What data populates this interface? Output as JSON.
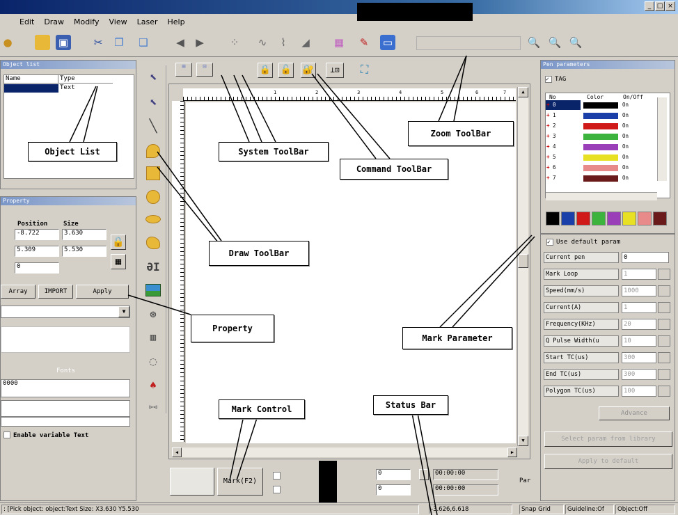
{
  "window": {
    "controls": [
      "_",
      "□",
      "×"
    ]
  },
  "menu": [
    "Edit",
    "Draw",
    "Modify",
    "View",
    "Laser",
    "Help"
  ],
  "object_list": {
    "title": "Object list",
    "columns": [
      "Name",
      "Type"
    ],
    "rows": [
      {
        "name": "",
        "type": "Text"
      }
    ]
  },
  "property": {
    "title": "Property",
    "headers": {
      "position": "Position",
      "size": "Size"
    },
    "x_pos": "-8.722",
    "x_size": "3.630",
    "y_pos": "5.309",
    "y_size": "5.530",
    "z": "0",
    "tabs": [
      "Array",
      "IMPORT",
      "Apply"
    ],
    "fonts_label": "Fonts",
    "text_value": "0000",
    "enable_variable_text": "Enable variable Text"
  },
  "canvas": {
    "ruler_numbers": [
      "1",
      "2",
      "3",
      "4",
      "5",
      "6",
      "7"
    ]
  },
  "mark_control": {
    "mark_button": "Mark(F2)",
    "field1": "0",
    "field2": "0",
    "time1": "00:00:00",
    "time2": "00:00:00",
    "param_btn": "Par"
  },
  "pens": {
    "title": "Pen parameters",
    "checkbox": "TAG",
    "columns": [
      "No",
      "Color",
      "On/Off"
    ],
    "rows": [
      {
        "no": "0",
        "color": "#000000",
        "state": "On"
      },
      {
        "no": "1",
        "color": "#1a3fa8",
        "state": "On"
      },
      {
        "no": "2",
        "color": "#d01a1a",
        "state": "On"
      },
      {
        "no": "3",
        "color": "#3cb33c",
        "state": "On"
      },
      {
        "no": "4",
        "color": "#9a3fb8",
        "state": "On"
      },
      {
        "no": "5",
        "color": "#e8e022",
        "state": "On"
      },
      {
        "no": "6",
        "color": "#e88a8a",
        "state": "On"
      },
      {
        "no": "7",
        "color": "#6a1a1a",
        "state": "On"
      }
    ],
    "palette": [
      "#000000",
      "#1a3fa8",
      "#d01a1a",
      "#3cb33c",
      "#9a3fb8",
      "#e8e022",
      "#e88a8a",
      "#6a1a1a"
    ]
  },
  "mark_params": {
    "use_default": "Use default param",
    "rows": [
      {
        "label": "Current pen",
        "value": "0"
      },
      {
        "label": "Mark Loop",
        "value": "1"
      },
      {
        "label": "Speed(mm/s)",
        "value": "1000"
      },
      {
        "label": "Current(A)",
        "value": "1"
      },
      {
        "label": "Frequency(KHz)",
        "value": "20"
      },
      {
        "label": "Q Pulse Width(u",
        "value": "10"
      },
      {
        "label": "Start TC(us)",
        "value": "300"
      },
      {
        "label": "End TC(us)",
        "value": "300"
      },
      {
        "label": "Polygon TC(us)",
        "value": "100"
      }
    ],
    "advance": "Advance",
    "select_param": "Select param from library",
    "apply_default": "Apply to default"
  },
  "status_bar": {
    "left": ": [Pick object: object:Text Size: X3.630 Y5.530",
    "coords": "-3.626,6.618",
    "snap": "Snap Grid",
    "guideline": "Guideline:Of",
    "object": "Object:Off"
  },
  "annotations": {
    "object_list": "Object List",
    "system_toolbar": "System ToolBar",
    "command_toolbar": "Command ToolBar",
    "zoom_toolbar": "Zoom ToolBar",
    "draw_toolbar": "Draw ToolBar",
    "property": "Property",
    "mark_parameter": "Mark Parameter",
    "mark_control": "Mark Control",
    "status_bar": "Status Bar"
  }
}
